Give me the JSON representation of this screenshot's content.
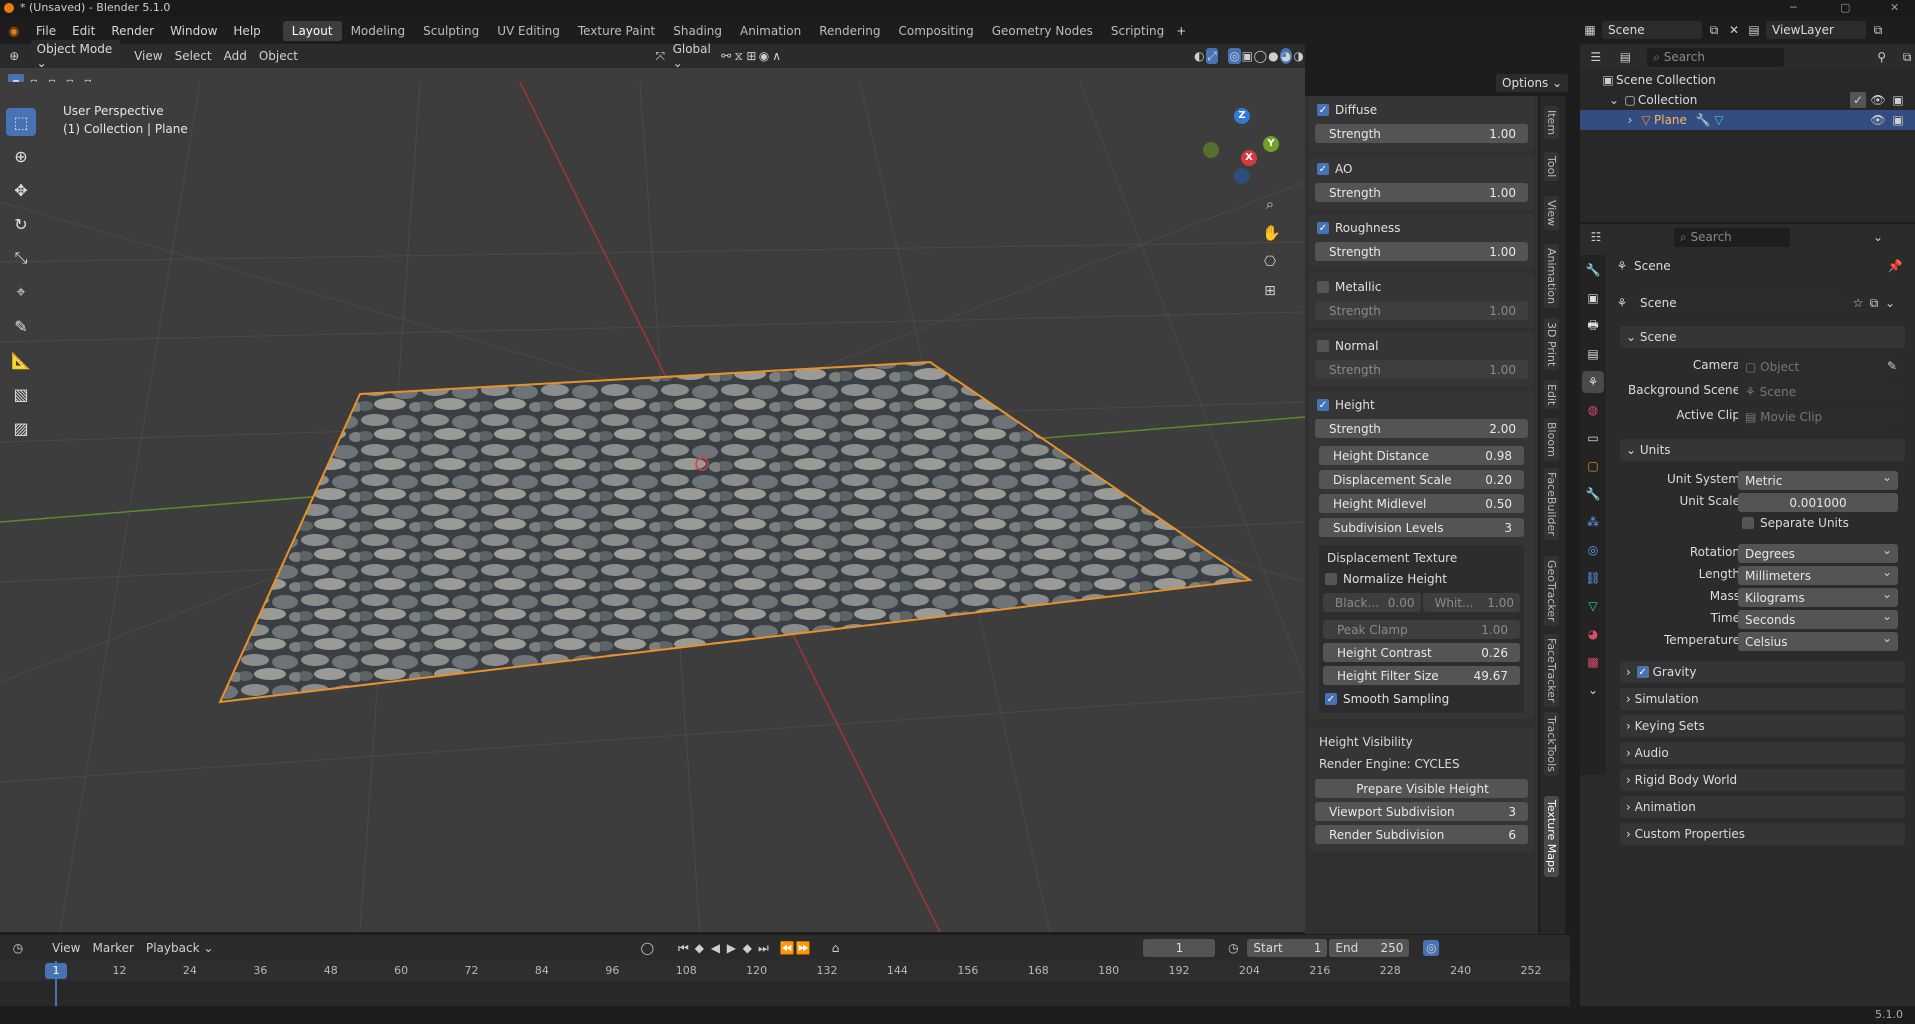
{
  "window": {
    "title": "* (Unsaved) - Blender 5.1.0"
  },
  "menus": [
    "File",
    "Edit",
    "Render",
    "Window",
    "Help"
  ],
  "workspaces": [
    "Layout",
    "Modeling",
    "Sculpting",
    "UV Editing",
    "Texture Paint",
    "Shading",
    "Animation",
    "Rendering",
    "Compositing",
    "Geometry Nodes",
    "Scripting"
  ],
  "active_workspace": "Layout",
  "scene_selector": "Scene",
  "viewlayer_selector": "ViewLayer",
  "viewport_header": {
    "mode": "Object Mode",
    "menus": [
      "View",
      "Select",
      "Add",
      "Object"
    ],
    "transform": "Global",
    "options": "Options"
  },
  "viewport_info": {
    "line1": "User Perspective",
    "line2": "(1) Collection | Plane"
  },
  "gizmo": {
    "z": "Z",
    "y": "Y",
    "x": "X"
  },
  "npanel": {
    "maps": [
      {
        "name": "Diffuse",
        "checked": true,
        "strength_label": "Strength",
        "strength": "1.00"
      },
      {
        "name": "AO",
        "checked": true,
        "strength_label": "Strength",
        "strength": "1.00"
      },
      {
        "name": "Roughness",
        "checked": true,
        "strength_label": "Strength",
        "strength": "1.00"
      },
      {
        "name": "Metallic",
        "checked": false,
        "strength_label": "Strength",
        "strength": "1.00"
      },
      {
        "name": "Normal",
        "checked": false,
        "strength_label": "Strength",
        "strength": "1.00"
      },
      {
        "name": "Height",
        "checked": true,
        "strength_label": "Strength",
        "strength": "2.00"
      }
    ],
    "height_fields": [
      {
        "label": "Height Distance",
        "value": "0.98"
      },
      {
        "label": "Displacement Scale",
        "value": "0.20"
      },
      {
        "label": "Height Midlevel",
        "value": "0.50"
      },
      {
        "label": "Subdivision Levels",
        "value": "3"
      }
    ],
    "displacement": {
      "title": "Displacement Texture",
      "normalize": "Normalize Height",
      "black_label": "Black...",
      "black": "0.00",
      "white_label": "Whit...",
      "white": "1.00",
      "peak_label": "Peak Clamp",
      "peak": "1.00",
      "contrast_label": "Height Contrast",
      "contrast": "0.26",
      "filter_label": "Height Filter Size",
      "filter": "49.67",
      "smooth": "Smooth Sampling"
    },
    "visibility": {
      "title": "Height Visibility",
      "engine": "Render Engine: CYCLES",
      "prepare": "Prepare Visible Height",
      "viewport_label": "Viewport Subdivision",
      "viewport": "3",
      "render_label": "Render Subdivision",
      "render": "6"
    },
    "tabs": [
      "Item",
      "Tool",
      "View",
      "Animation",
      "3D Print",
      "Edit",
      "Bloom",
      "FaceBuilder",
      "GeoTracker",
      "FaceTracker",
      "TrackTools",
      "Texture Maps"
    ]
  },
  "timeline": {
    "menus": [
      "View",
      "Marker",
      "Playback"
    ],
    "current_frame": "1",
    "start_label": "Start",
    "start": "1",
    "end_label": "End",
    "end": "250",
    "ticks": [
      "1",
      "12",
      "24",
      "36",
      "48",
      "60",
      "72",
      "84",
      "96",
      "108",
      "120",
      "132",
      "144",
      "156",
      "168",
      "180",
      "192",
      "204",
      "216",
      "228",
      "240",
      "252"
    ]
  },
  "outliner": {
    "search_placeholder": "Search",
    "scene_collection": "Scene Collection",
    "collection": "Collection",
    "object": "Plane"
  },
  "properties": {
    "search_placeholder": "Search",
    "context": "Scene",
    "scene_name": "Scene",
    "scene_panel": "Scene",
    "camera_label": "Camera",
    "camera": "Object",
    "bg_label": "Background Scene",
    "bg": "Scene",
    "clip_label": "Active Clip",
    "clip": "Movie Clip",
    "units_panel": "Units",
    "unit_system_label": "Unit System",
    "unit_system": "Metric",
    "unit_scale_label": "Unit Scale",
    "unit_scale": "0.001000",
    "separate_units": "Separate Units",
    "rotation_label": "Rotation",
    "rotation": "Degrees",
    "length_label": "Length",
    "length": "Millimeters",
    "mass_label": "Mass",
    "mass": "Kilograms",
    "time_label": "Time",
    "time": "Seconds",
    "temp_label": "Temperature",
    "temp": "Celsius",
    "panels": [
      "Gravity",
      "Simulation",
      "Keying Sets",
      "Audio",
      "Rigid Body World",
      "Animation",
      "Custom Properties"
    ]
  },
  "status": {
    "version": "5.1.0"
  },
  "colors": {
    "accent": "#4772b3",
    "selection": "#e8912b"
  }
}
